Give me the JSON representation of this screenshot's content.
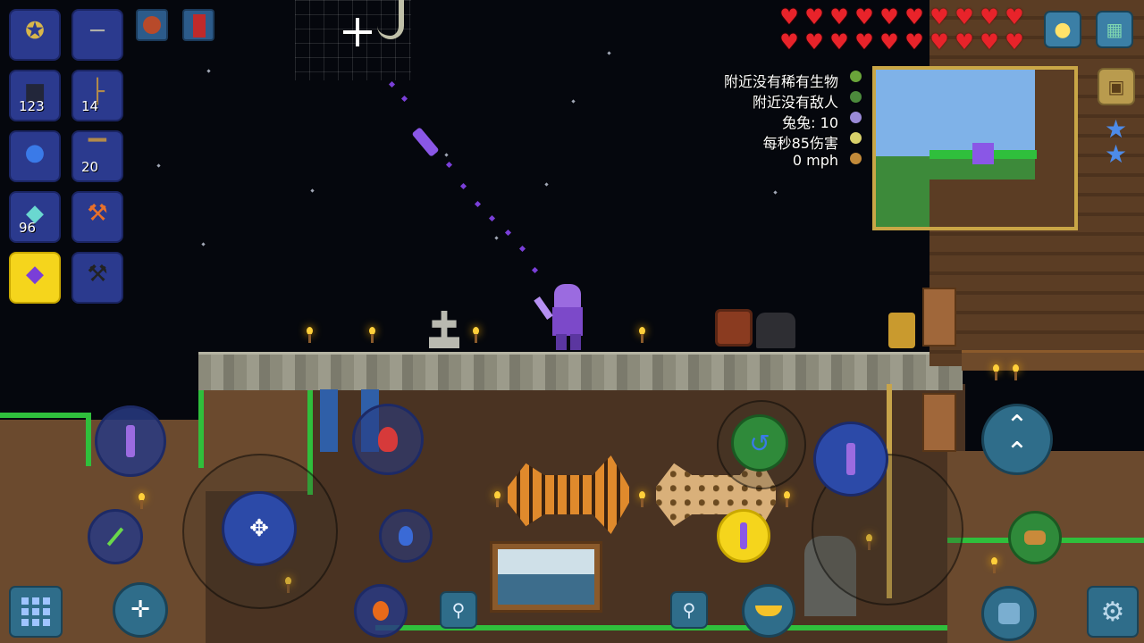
{
  "hotbar": [
    {
      "icon": "axe-icon",
      "count": ""
    },
    {
      "icon": "gun-icon",
      "count": ""
    },
    {
      "icon": "block-icon",
      "count": "123"
    },
    {
      "icon": "chair-icon",
      "count": "14"
    },
    {
      "icon": "potion-icon",
      "count": ""
    },
    {
      "icon": "table-icon",
      "count": "20"
    },
    {
      "icon": "crystal-shard-icon",
      "count": "96"
    },
    {
      "icon": "hammer-icon",
      "count": ""
    },
    {
      "icon": "magic-weapon-icon",
      "count": "",
      "selected": true
    },
    {
      "icon": "pickaxe-icon",
      "count": ""
    }
  ],
  "buffs": [
    {
      "icon": "buff-icon-1"
    },
    {
      "icon": "buff-icon-2"
    }
  ],
  "health": {
    "hearts_full": 20,
    "hearts_total": 20
  },
  "info": {
    "rare_creatures": "附近没有稀有生物",
    "enemies": "附近没有敌人",
    "kills": "兔兔: 10",
    "dps": "每秒85伤害",
    "speed": "0 mph"
  },
  "colors": {
    "hotbar_slot": "#2b3a8e",
    "hotbar_selected": "#f5d51c",
    "heart": "#e8232a",
    "minimap_frame": "#c9a646",
    "button_blue": "#283a82",
    "teal_button": "#2f6d8a"
  },
  "controls": {
    "inventory": "grid-icon",
    "smart_cursor": "crosshair-icon",
    "zoom_out": "zoom-out-icon",
    "zoom_in": "zoom-in-icon",
    "jump": "double-chevron-up-icon",
    "settings": "gear-icon",
    "housing": "lightbulb-icon",
    "map": "map-icon",
    "camera": "camera-icon",
    "grapple": "hook-icon",
    "mount": "saddle-icon"
  }
}
